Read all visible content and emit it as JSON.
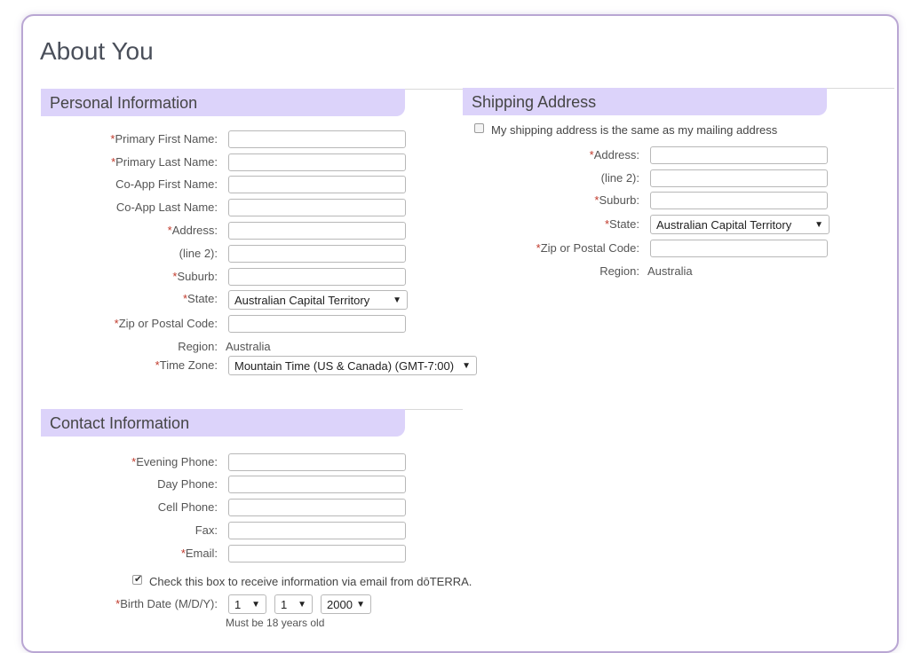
{
  "page": {
    "title": "About You"
  },
  "personal": {
    "heading": "Personal Information",
    "required_mark": "*",
    "primary_first_name_label": "Primary First Name:",
    "primary_last_name_label": "Primary Last Name:",
    "coapp_first_name_label": "Co-App First Name:",
    "coapp_last_name_label": "Co-App Last Name:",
    "address_label": "Address:",
    "line2_label": "(line 2):",
    "suburb_label": "Suburb:",
    "state_label": "State:",
    "state_value": "Australian Capital Territory",
    "zip_label": "Zip or Postal Code:",
    "region_label": "Region:",
    "region_value": "Australia",
    "timezone_label": "Time Zone:",
    "timezone_value": "Mountain Time (US & Canada) (GMT-7:00)"
  },
  "shipping": {
    "heading": "Shipping Address",
    "same_address_label": "My shipping address is the same as my mailing address",
    "same_address_checked": false,
    "address_label": "Address:",
    "line2_label": "(line 2):",
    "suburb_label": "Suburb:",
    "state_label": "State:",
    "state_value": "Australian Capital Territory",
    "zip_label": "Zip or Postal Code:",
    "region_label": "Region:",
    "region_value": "Australia"
  },
  "contact": {
    "heading": "Contact Information",
    "evening_phone_label": "Evening Phone:",
    "day_phone_label": "Day Phone:",
    "cell_phone_label": "Cell Phone:",
    "fax_label": "Fax:",
    "email_label": "Email:",
    "email_opt_in_label": "Check this box to receive information via email from dōTERRA.",
    "email_opt_in_checked": true,
    "birth_date_label": "Birth Date (M/D/Y):",
    "birth_month": "1",
    "birth_day": "1",
    "birth_year": "2000",
    "age_note": "Must be 18 years old"
  },
  "icons": {
    "dropdown": "chevron-down-icon",
    "check": "check-icon"
  }
}
